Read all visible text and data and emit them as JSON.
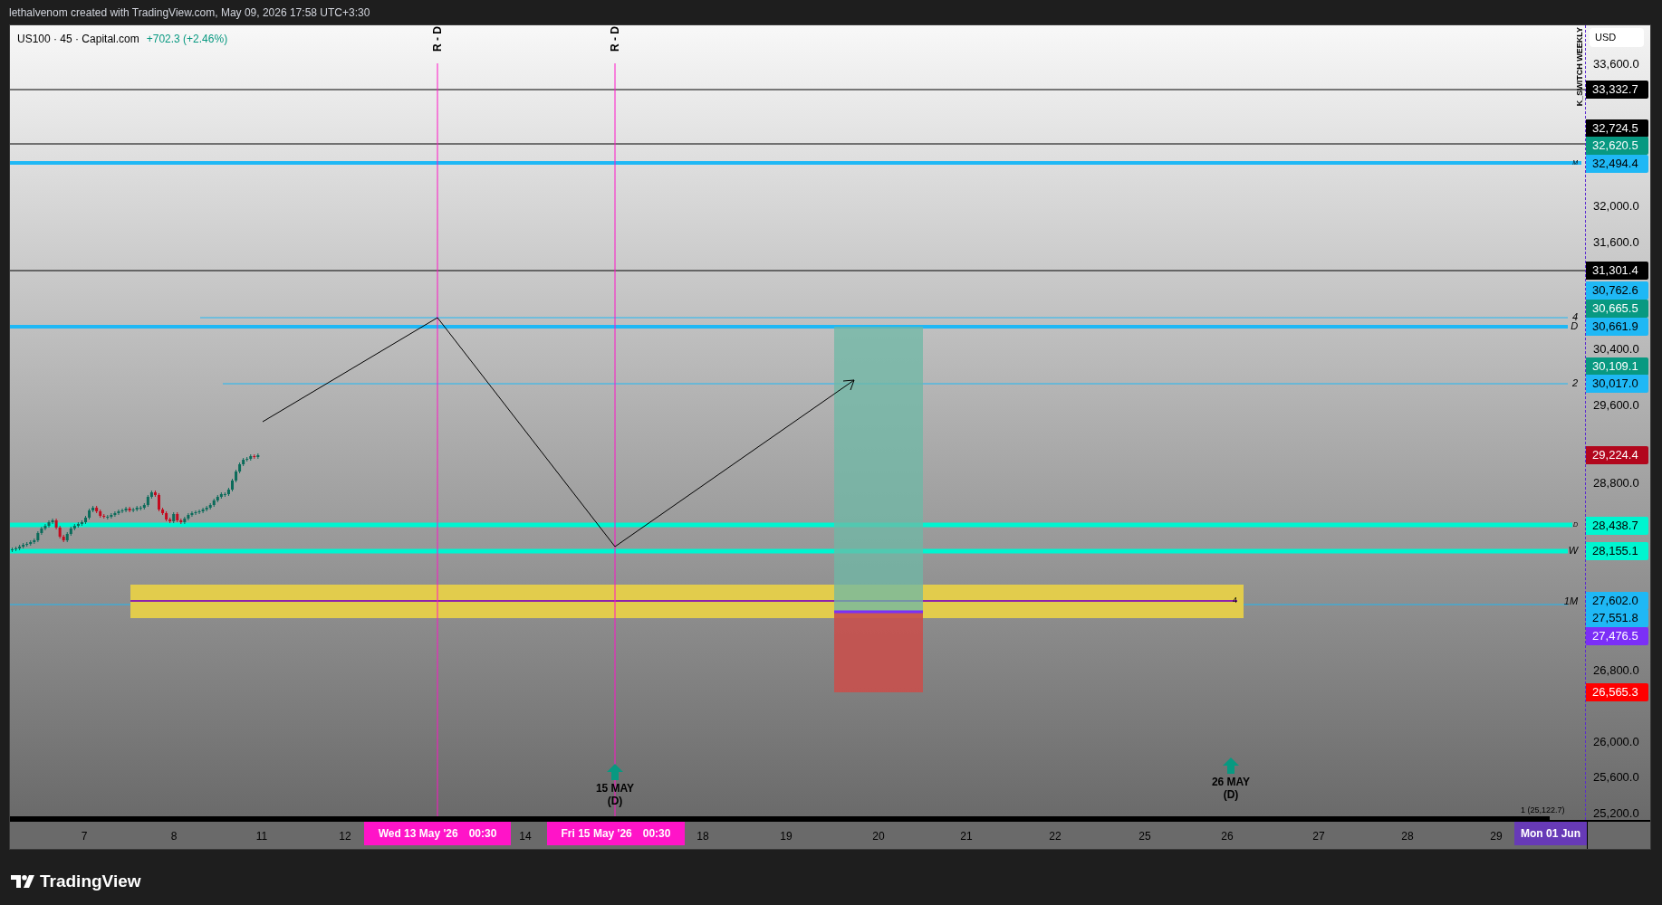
{
  "header": {
    "text": "lethalvenom created with TradingView.com, May 09, 2026 17:58 UTC+3:30"
  },
  "legend": {
    "symbol": "US100 · 45 · Capital.com",
    "change": "+702.3 (+2.46%)"
  },
  "vertical_markers": [
    {
      "label": "R - D"
    },
    {
      "label": "R - D"
    }
  ],
  "line_labels": [
    {
      "label": "M"
    },
    {
      "label": "4"
    },
    {
      "label": "D"
    },
    {
      "label": "2"
    },
    {
      "label": "D"
    },
    {
      "label": "W"
    },
    {
      "label": "1M"
    }
  ],
  "zone_label": "4",
  "indicator_label": "K_SWITCH WEEKLY",
  "event_markers": [
    {
      "date": "15 MAY",
      "tag": "(D)"
    },
    {
      "date": "26 MAY",
      "tag": "(D)"
    }
  ],
  "footnote": "1 (25,122.7)",
  "price_axis": {
    "currency": "USD",
    "ticks": [
      "33,600.0",
      "32,000.0",
      "31,600.0",
      "30,400.0",
      "29,600.0",
      "28,800.0",
      "26,800.0",
      "26,000.0",
      "25,600.0",
      "25,200.0"
    ],
    "badges": [
      {
        "value": "33,332.7",
        "color": "#000000"
      },
      {
        "value": "32,724.5",
        "color": "#000000"
      },
      {
        "value": "32,620.5",
        "color": "#089981"
      },
      {
        "value": "32,494.4",
        "color": "#1fb8f5"
      },
      {
        "value": "31,301.4",
        "color": "#000000"
      },
      {
        "value": "30,762.6",
        "color": "#1fb8f5"
      },
      {
        "value": "30,665.5",
        "color": "#089981"
      },
      {
        "value": "30,661.9",
        "color": "#1fb8f5"
      },
      {
        "value": "30,109.1",
        "color": "#089981"
      },
      {
        "value": "30,017.0",
        "color": "#1fb8f5"
      },
      {
        "value": "29,224.4",
        "color": "#b2071d"
      },
      {
        "value": "28,438.7",
        "color": "#00f5d0"
      },
      {
        "value": "28,155.1",
        "color": "#00f5d0"
      },
      {
        "value": "27,602.0",
        "color": "#1fb8f5"
      },
      {
        "value": "27,551.8",
        "color": "#1fb8f5"
      },
      {
        "value": "27,476.5",
        "color": "#7b2ff7"
      },
      {
        "value": "26,565.3",
        "color": "#ff0000"
      }
    ]
  },
  "time_axis": {
    "ticks": [
      "7",
      "8",
      "11",
      "12",
      "14",
      "18",
      "19",
      "20",
      "21",
      "22",
      "25",
      "26",
      "27",
      "28",
      "29"
    ],
    "badges": [
      {
        "date": "Wed 13 May '26",
        "time": "00:30",
        "color": "#ff14c8"
      },
      {
        "date": "Fri 15 May '26",
        "time": "00:30",
        "color": "#ff14c8"
      },
      {
        "date": "Mon 01 Jun",
        "color": "#673ab7"
      }
    ]
  },
  "brand": "TradingView"
}
